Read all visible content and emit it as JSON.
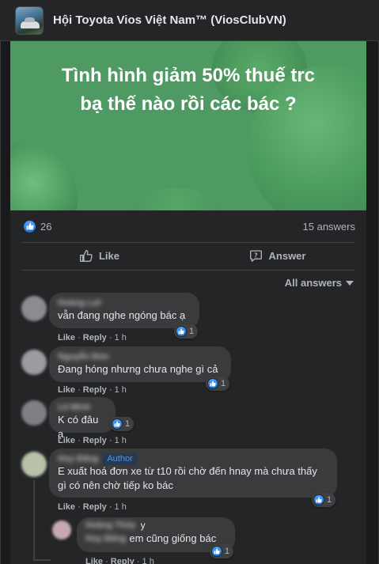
{
  "group": {
    "name": "Hội Toyota Vios Việt Nam™ (ViosClubVN)",
    "avatar_icon": "group-photo-car"
  },
  "post": {
    "banner_line1": "Tình hình giảm 50% thuế trc",
    "banner_line2": "bạ thế nào rồi các bác ?",
    "banner_color": "#4f9a63",
    "likes": "26",
    "answers": "15 answers",
    "actions": {
      "like": "Like",
      "answer": "Answer"
    },
    "sort_label": "All answers"
  },
  "comments": [
    {
      "author": "Hoàng Lợi",
      "text": "vẫn đang nghe ngóng bác ạ",
      "reactions": "1",
      "like": "Like",
      "reply": "Reply",
      "time": "1 h",
      "avatar_color": "#8a8c91"
    },
    {
      "author": "Nguyễn Đức",
      "text": "Đang hóng nhưng chưa nghe gì cả",
      "reactions": "1",
      "like": "Like",
      "reply": "Reply",
      "time": "1 h",
      "avatar_color": "#9a9ca1"
    },
    {
      "author": "Lê Minh",
      "text": "K có đâu ạ",
      "reactions": "1",
      "like": "Like",
      "reply": "Reply",
      "time": "1 h",
      "avatar_color": "#7e8085"
    },
    {
      "author": "Huy Đăng",
      "badge": "Author",
      "text_line1": "E xuất hoá đơn xe từ t10 rồi chờ đến hnay mà chưa thấy",
      "text_line2": "gì có nên chờ tiếp ko bác",
      "reactions": "1",
      "like": "Like",
      "reply": "Reply",
      "time": "1 h",
      "avatar_color": "#b9c2a8"
    }
  ],
  "reply": {
    "author_line1": "Hoàng Thủy",
    "author_line2": "Huy Đăng",
    "suffix": "y",
    "text": "em cũng giống bác",
    "reactions": "1",
    "like": "Like",
    "reply": "Reply",
    "time": "1 h",
    "avatar_color": "#c7a9b5"
  }
}
